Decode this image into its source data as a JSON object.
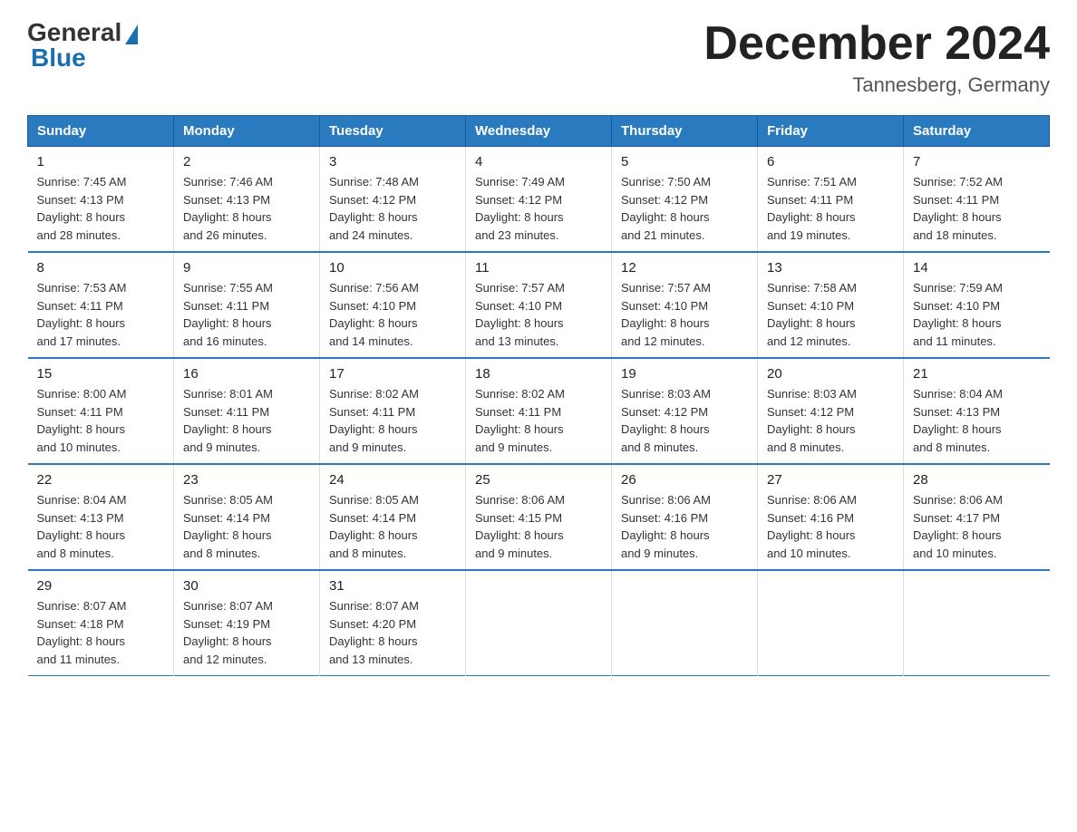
{
  "logo": {
    "general": "General",
    "blue": "Blue"
  },
  "title": "December 2024",
  "location": "Tannesberg, Germany",
  "days_header": [
    "Sunday",
    "Monday",
    "Tuesday",
    "Wednesday",
    "Thursday",
    "Friday",
    "Saturday"
  ],
  "weeks": [
    [
      {
        "day": "1",
        "sunrise": "7:45 AM",
        "sunset": "4:13 PM",
        "daylight": "8 hours and 28 minutes."
      },
      {
        "day": "2",
        "sunrise": "7:46 AM",
        "sunset": "4:13 PM",
        "daylight": "8 hours and 26 minutes."
      },
      {
        "day": "3",
        "sunrise": "7:48 AM",
        "sunset": "4:12 PM",
        "daylight": "8 hours and 24 minutes."
      },
      {
        "day": "4",
        "sunrise": "7:49 AM",
        "sunset": "4:12 PM",
        "daylight": "8 hours and 23 minutes."
      },
      {
        "day": "5",
        "sunrise": "7:50 AM",
        "sunset": "4:12 PM",
        "daylight": "8 hours and 21 minutes."
      },
      {
        "day": "6",
        "sunrise": "7:51 AM",
        "sunset": "4:11 PM",
        "daylight": "8 hours and 19 minutes."
      },
      {
        "day": "7",
        "sunrise": "7:52 AM",
        "sunset": "4:11 PM",
        "daylight": "8 hours and 18 minutes."
      }
    ],
    [
      {
        "day": "8",
        "sunrise": "7:53 AM",
        "sunset": "4:11 PM",
        "daylight": "8 hours and 17 minutes."
      },
      {
        "day": "9",
        "sunrise": "7:55 AM",
        "sunset": "4:11 PM",
        "daylight": "8 hours and 16 minutes."
      },
      {
        "day": "10",
        "sunrise": "7:56 AM",
        "sunset": "4:10 PM",
        "daylight": "8 hours and 14 minutes."
      },
      {
        "day": "11",
        "sunrise": "7:57 AM",
        "sunset": "4:10 PM",
        "daylight": "8 hours and 13 minutes."
      },
      {
        "day": "12",
        "sunrise": "7:57 AM",
        "sunset": "4:10 PM",
        "daylight": "8 hours and 12 minutes."
      },
      {
        "day": "13",
        "sunrise": "7:58 AM",
        "sunset": "4:10 PM",
        "daylight": "8 hours and 12 minutes."
      },
      {
        "day": "14",
        "sunrise": "7:59 AM",
        "sunset": "4:10 PM",
        "daylight": "8 hours and 11 minutes."
      }
    ],
    [
      {
        "day": "15",
        "sunrise": "8:00 AM",
        "sunset": "4:11 PM",
        "daylight": "8 hours and 10 minutes."
      },
      {
        "day": "16",
        "sunrise": "8:01 AM",
        "sunset": "4:11 PM",
        "daylight": "8 hours and 9 minutes."
      },
      {
        "day": "17",
        "sunrise": "8:02 AM",
        "sunset": "4:11 PM",
        "daylight": "8 hours and 9 minutes."
      },
      {
        "day": "18",
        "sunrise": "8:02 AM",
        "sunset": "4:11 PM",
        "daylight": "8 hours and 9 minutes."
      },
      {
        "day": "19",
        "sunrise": "8:03 AM",
        "sunset": "4:12 PM",
        "daylight": "8 hours and 8 minutes."
      },
      {
        "day": "20",
        "sunrise": "8:03 AM",
        "sunset": "4:12 PM",
        "daylight": "8 hours and 8 minutes."
      },
      {
        "day": "21",
        "sunrise": "8:04 AM",
        "sunset": "4:13 PM",
        "daylight": "8 hours and 8 minutes."
      }
    ],
    [
      {
        "day": "22",
        "sunrise": "8:04 AM",
        "sunset": "4:13 PM",
        "daylight": "8 hours and 8 minutes."
      },
      {
        "day": "23",
        "sunrise": "8:05 AM",
        "sunset": "4:14 PM",
        "daylight": "8 hours and 8 minutes."
      },
      {
        "day": "24",
        "sunrise": "8:05 AM",
        "sunset": "4:14 PM",
        "daylight": "8 hours and 8 minutes."
      },
      {
        "day": "25",
        "sunrise": "8:06 AM",
        "sunset": "4:15 PM",
        "daylight": "8 hours and 9 minutes."
      },
      {
        "day": "26",
        "sunrise": "8:06 AM",
        "sunset": "4:16 PM",
        "daylight": "8 hours and 9 minutes."
      },
      {
        "day": "27",
        "sunrise": "8:06 AM",
        "sunset": "4:16 PM",
        "daylight": "8 hours and 10 minutes."
      },
      {
        "day": "28",
        "sunrise": "8:06 AM",
        "sunset": "4:17 PM",
        "daylight": "8 hours and 10 minutes."
      }
    ],
    [
      {
        "day": "29",
        "sunrise": "8:07 AM",
        "sunset": "4:18 PM",
        "daylight": "8 hours and 11 minutes."
      },
      {
        "day": "30",
        "sunrise": "8:07 AM",
        "sunset": "4:19 PM",
        "daylight": "8 hours and 12 minutes."
      },
      {
        "day": "31",
        "sunrise": "8:07 AM",
        "sunset": "4:20 PM",
        "daylight": "8 hours and 13 minutes."
      },
      null,
      null,
      null,
      null
    ]
  ]
}
